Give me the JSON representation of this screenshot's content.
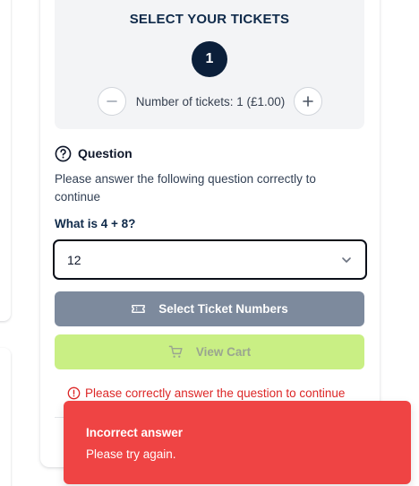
{
  "tickets": {
    "heading": "SELECT YOUR TICKETS",
    "count": "1",
    "label": "Number of tickets: 1 (£1.00)",
    "minus_icon": "minus-icon",
    "plus_icon": "plus-icon"
  },
  "question": {
    "icon": "question-circle-icon",
    "title": "Question",
    "description": "Please answer the following question correctly to continue",
    "text": "What is 4 + 8?",
    "selected_answer": "12",
    "dropdown_icon": "chevron-down-icon"
  },
  "buttons": {
    "select_numbers": "Select Ticket Numbers",
    "select_numbers_icon": "ticket-icon",
    "view_cart": "View Cart",
    "view_cart_icon": "cart-icon"
  },
  "error": {
    "icon": "alert-circle-icon",
    "message": "Please correctly answer the question to continue"
  },
  "toast": {
    "title": "Incorrect answer",
    "message": "Please try again."
  },
  "colors": {
    "navy": "#0b1f3a",
    "error_red": "#dc2626",
    "toast_red": "#ef4444",
    "slate_button": "#7d8a9d",
    "lime_button": "#c9ef84"
  }
}
